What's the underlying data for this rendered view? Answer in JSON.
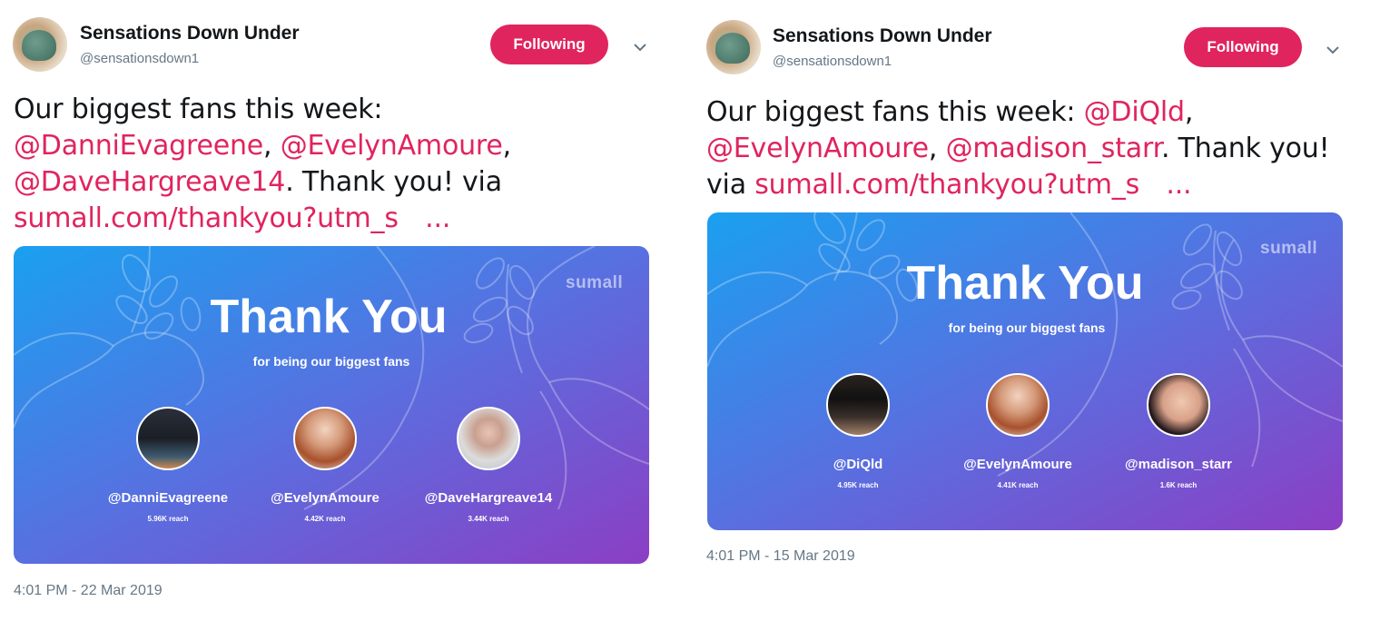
{
  "tweets": [
    {
      "user": {
        "name": "Sensations Down Under",
        "handle": "@sensationsdown1"
      },
      "follow_label": "Following",
      "text": {
        "intro": "Our biggest fans this week:",
        "mentions": [
          "@DanniEvagreene",
          "@EvelynAmoure",
          "@DaveHargreave14"
        ],
        "sep": ",",
        "outro": ". Thank you! via",
        "link": "sumall.com/thankyou?utm_s",
        "ellipsis": "..."
      },
      "card": {
        "brand": "sumall",
        "title": "Thank You",
        "subtitle": "for being our biggest fans",
        "fans": [
          {
            "name": "@DanniEvagreene",
            "reach": "5.96K reach"
          },
          {
            "name": "@EvelynAmoure",
            "reach": "4.42K reach"
          },
          {
            "name": "@DaveHargreave14",
            "reach": "3.44K reach"
          }
        ]
      },
      "timestamp": "4:01 PM - 22 Mar 2019"
    },
    {
      "user": {
        "name": "Sensations Down Under",
        "handle": "@sensationsdown1"
      },
      "follow_label": "Following",
      "text": {
        "intro": "Our biggest fans this week:",
        "mentions": [
          "@DiQld",
          "@EvelynAmoure",
          "@madison_starr"
        ],
        "sep": ",",
        "outro": ". Thank you!",
        "via": "via",
        "link": "sumall.com/thankyou?utm_s",
        "ellipsis": "..."
      },
      "card": {
        "brand": "sumall",
        "title": "Thank You",
        "subtitle": "for being our biggest fans",
        "fans": [
          {
            "name": "@DiQld",
            "reach": "4.95K reach"
          },
          {
            "name": "@EvelynAmoure",
            "reach": "4.41K reach"
          },
          {
            "name": "@madison_starr",
            "reach": "1.6K reach"
          }
        ]
      },
      "timestamp": "4:01 PM - 15 Mar 2019"
    }
  ],
  "colors": {
    "accent": "#e0245e",
    "text": "#14171a",
    "muted": "#657786",
    "card_gradient_start": "#1aa0f0",
    "card_gradient_mid": "#5870e0",
    "card_gradient_end": "#8c3ec4"
  },
  "icons": {
    "caret": "chevron-down-icon",
    "leaves": "leaf-branch-decoration"
  }
}
